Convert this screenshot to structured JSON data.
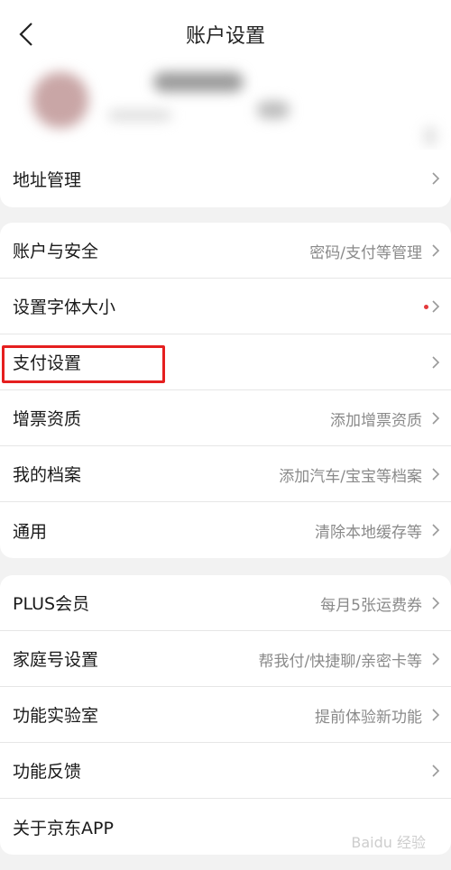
{
  "header": {
    "title": "账户设置",
    "back_icon": "chevron-left-icon"
  },
  "group1": [
    {
      "label": "地址管理",
      "sub": ""
    }
  ],
  "group2": [
    {
      "label": "账户与安全",
      "sub": "密码/支付等管理"
    },
    {
      "label": "设置字体大小",
      "sub": "",
      "dot": true
    },
    {
      "label": "支付设置",
      "sub": ""
    },
    {
      "label": "增票资质",
      "sub": "添加增票资质"
    },
    {
      "label": "我的档案",
      "sub": "添加汽车/宝宝等档案"
    },
    {
      "label": "通用",
      "sub": "清除本地缓存等"
    }
  ],
  "group3": [
    {
      "label": "PLUS会员",
      "sub": "每月5张运费券"
    },
    {
      "label": "家庭号设置",
      "sub": "帮我付/快捷聊/亲密卡等"
    },
    {
      "label": "功能实验室",
      "sub": "提前体验新功能"
    },
    {
      "label": "功能反馈",
      "sub": ""
    },
    {
      "label": "关于京东APP",
      "sub": ""
    }
  ],
  "watermark": "Baidu 经验",
  "colors": {
    "highlight": "#e51f1f",
    "dot": "#e4393c"
  }
}
